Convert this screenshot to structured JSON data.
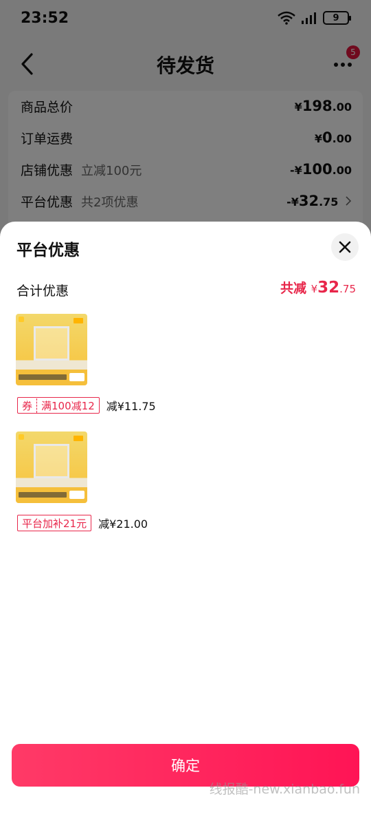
{
  "status_bar": {
    "time": "23:52",
    "battery": "9"
  },
  "nav": {
    "title": "待发货",
    "badge_count": "5"
  },
  "price_card": {
    "rows": [
      {
        "label": "商品总价",
        "sub": "",
        "currency": "¥",
        "amount": "198",
        "cents": ".00"
      },
      {
        "label": "订单运费",
        "sub": "",
        "currency": "¥",
        "amount": "0",
        "cents": ".00"
      },
      {
        "label": "店铺优惠",
        "sub": "立减100元",
        "currency": "-¥",
        "amount": "100",
        "cents": ".00"
      },
      {
        "label": "平台优惠",
        "sub": "共2项优惠",
        "currency": "-¥",
        "amount": "32",
        "cents": ".75"
      }
    ]
  },
  "sheet": {
    "title": "平台优惠",
    "summary_label": "合计优惠",
    "summary_prefix": "共减",
    "summary_currency": "¥",
    "summary_amount": "32",
    "summary_cents": ".75",
    "items": [
      {
        "coupon_tag": "券",
        "coupon_text": "满100减12",
        "saving": "减¥11.75"
      },
      {
        "coupon_tag": "",
        "coupon_text": "平台加补21元",
        "saving": "减¥21.00"
      }
    ],
    "confirm_label": "确定"
  },
  "watermark": "线报酷-new.xianbao.fun",
  "colors": {
    "accent": "#e8264a",
    "button": "#ff1f5a",
    "badge": "#e0143c"
  }
}
